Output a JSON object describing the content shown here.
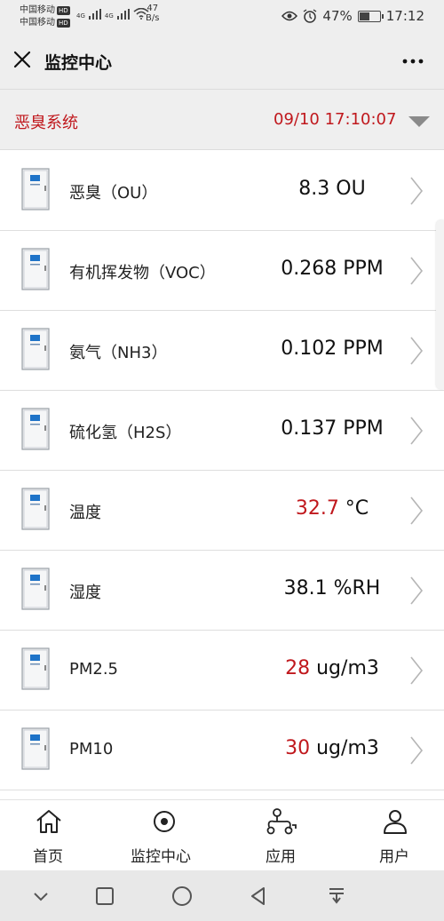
{
  "status_bar": {
    "carrier1": "中国移动",
    "carrier2": "中国移动",
    "hd_badge": "HD",
    "net_type": "4G",
    "speed_value": "47",
    "speed_unit": "B/s",
    "battery_percent": "47%",
    "time": "17:12"
  },
  "header": {
    "title": "监控中心"
  },
  "system": {
    "name": "恶臭系统",
    "timestamp": "09/10 17:10:07"
  },
  "colors": {
    "accent_red": "#c0181d",
    "header_bg": "#eeeeee"
  },
  "readings": [
    {
      "label": "恶臭（OU）",
      "value": "8.3",
      "unit": " OU",
      "alert": false
    },
    {
      "label": "有机挥发物（VOC）",
      "value": "0.268",
      "unit": " PPM",
      "alert": false
    },
    {
      "label": "氨气（NH3）",
      "value": "0.102",
      "unit": " PPM",
      "alert": false
    },
    {
      "label": "硫化氢（H2S）",
      "value": "0.137",
      "unit": " PPM",
      "alert": false
    },
    {
      "label": "温度",
      "value": "32.7",
      "unit": " °C",
      "alert": true
    },
    {
      "label": "湿度",
      "value": "38.1",
      "unit": " %RH",
      "alert": false
    },
    {
      "label": "PM2.5",
      "value": "28",
      "unit": " ug/m3",
      "alert": true
    },
    {
      "label": "PM10",
      "value": "30",
      "unit": " ug/m3",
      "alert": true
    }
  ],
  "bottom_nav": {
    "home": "首页",
    "monitor": "监控中心",
    "apps": "应用",
    "user": "用户"
  },
  "icons": {
    "close": "close-icon",
    "more": "more-icon",
    "dropdown": "triangle-down-icon",
    "device": "device-cabinet-icon",
    "chevron": "chevron-right-icon",
    "home": "house-icon",
    "monitor": "target-icon",
    "apps": "apps-icon",
    "user": "user-icon"
  }
}
